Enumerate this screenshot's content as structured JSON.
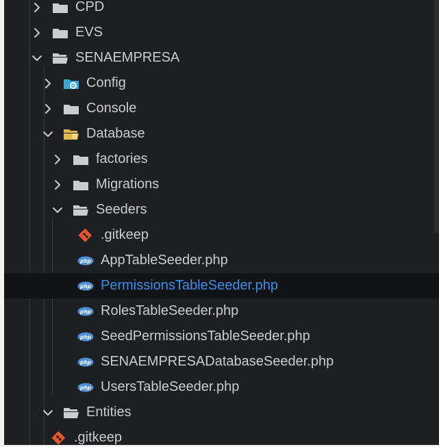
{
  "colors": {
    "background": "#1e1f22",
    "selected_background": "#131417",
    "selected_text": "#3b8eea",
    "text": "#c9ccd1",
    "folder": "#c9ccd1",
    "config_folder": "#3aa7d6",
    "database_folder": "#e0b84c",
    "git_icon": "#e4572e",
    "php_icon": "#4f8fd6"
  },
  "tree": [
    {
      "label": "CPD",
      "kind": "folder",
      "expanded": false,
      "depth": 0,
      "icon": "folder-icon"
    },
    {
      "label": "EVS",
      "kind": "folder",
      "expanded": false,
      "depth": 0,
      "icon": "folder-icon"
    },
    {
      "label": "SENAEMPRESA",
      "kind": "folder",
      "expanded": true,
      "depth": 0,
      "icon": "folder-open-icon",
      "modified": true
    },
    {
      "label": "Config",
      "kind": "folder",
      "expanded": false,
      "depth": 1,
      "icon": "config-folder-icon"
    },
    {
      "label": "Console",
      "kind": "folder",
      "expanded": false,
      "depth": 1,
      "icon": "folder-icon"
    },
    {
      "label": "Database",
      "kind": "folder",
      "expanded": true,
      "depth": 1,
      "icon": "database-folder-open-icon"
    },
    {
      "label": "factories",
      "kind": "folder",
      "expanded": false,
      "depth": 2,
      "icon": "folder-icon"
    },
    {
      "label": "Migrations",
      "kind": "folder",
      "expanded": false,
      "depth": 2,
      "icon": "folder-icon"
    },
    {
      "label": "Seeders",
      "kind": "folder",
      "expanded": true,
      "depth": 2,
      "icon": "folder-open-icon"
    },
    {
      "label": ".gitkeep",
      "kind": "file",
      "depth": 3,
      "icon": "git-icon"
    },
    {
      "label": "AppTableSeeder.php",
      "kind": "file",
      "depth": 3,
      "icon": "php-icon"
    },
    {
      "label": "PermissionsTableSeeder.php",
      "kind": "file",
      "depth": 3,
      "icon": "php-icon",
      "selected": true
    },
    {
      "label": "RolesTableSeeder.php",
      "kind": "file",
      "depth": 3,
      "icon": "php-icon"
    },
    {
      "label": "SeedPermissionsTableSeeder.php",
      "kind": "file",
      "depth": 3,
      "icon": "php-icon"
    },
    {
      "label": "SENAEMPRESADatabaseSeeder.php",
      "kind": "file",
      "depth": 3,
      "icon": "php-icon"
    },
    {
      "label": "UsersTableSeeder.php",
      "kind": "file",
      "depth": 3,
      "icon": "php-icon"
    },
    {
      "label": "Entities",
      "kind": "folder",
      "expanded": true,
      "depth": 1,
      "icon": "folder-open-icon"
    },
    {
      "label": ".gitkeep",
      "kind": "file",
      "depth": 2,
      "icon": "git-icon"
    }
  ]
}
